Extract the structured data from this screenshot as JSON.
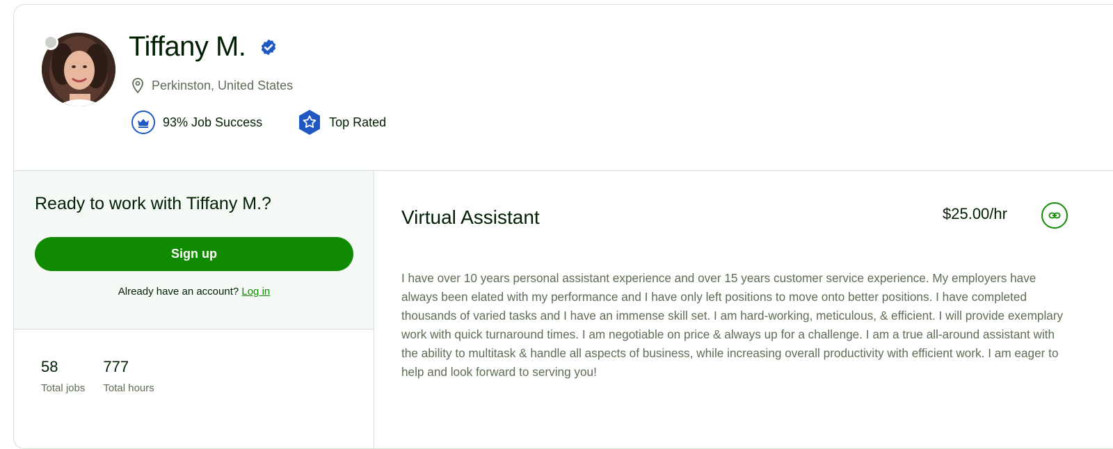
{
  "profile": {
    "name": "Tiffany M.",
    "location": "Perkinston, United States",
    "job_success": "93% Job Success",
    "badge": "Top Rated",
    "verified_icon": "verified-check-icon"
  },
  "cta": {
    "heading": "Ready to work with Tiffany M.?",
    "signup_label": "Sign up",
    "account_prompt": "Already have an account?",
    "login_label": "Log in"
  },
  "stats": [
    {
      "value": "58",
      "label": "Total jobs"
    },
    {
      "value": "777",
      "label": "Total hours"
    }
  ],
  "job": {
    "title": "Virtual Assistant",
    "rate": "$25.00/hr",
    "description": "I have over 10 years personal assistant experience and over 15 years customer service experience. My employers have always been elated with my performance and I have only left positions to move onto better positions. I have completed thousands of varied tasks and I have an immense skill set. I am hard-working, meticulous, & efficient. I will provide exemplary work with quick turnaround times. I am negotiable on price & always up for a challenge. I am a true all-around assistant with the ability to multitask & handle all aspects of business, while increasing overall productivity with efficient work. I am eager to help and look forward to serving you!"
  },
  "colors": {
    "brand_green": "#108a00",
    "badge_blue": "#1f57c3",
    "border": "#d5e0d5",
    "muted_text": "#5e6d55"
  }
}
